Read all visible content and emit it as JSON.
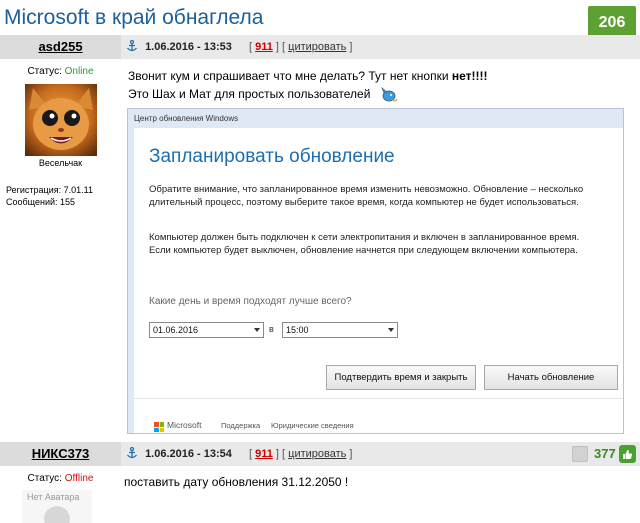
{
  "topic": {
    "title": "Microsoft в край обнаглела",
    "rating": "206",
    "vote_minus": "–",
    "vote_plus": "+"
  },
  "posts": [
    {
      "author": "asd255",
      "date": "1.06.2016 - 13:53",
      "post_number": "911",
      "cite_label": "цитировать",
      "status_label": "Статус:",
      "status": "Online",
      "rank": "Весельчак",
      "registration": "Регистрация: 7.01.11",
      "messages": "Сообщений: 155",
      "text_line1_prefix": "Звонит кум и спрашивает что мне делать? Тут нет кнопки ",
      "text_line1_bold": "нет!!!!",
      "text_line2": "Это Шах и Мат для простых пользователей"
    },
    {
      "author": "НИКС373",
      "date": "1.06.2016 - 13:54",
      "post_number": "911",
      "cite_label": "цитировать",
      "status_label": "Статус:",
      "status": "Offline",
      "score": "377",
      "avatar_placeholder": "Нет Аватара",
      "text": "поставить дату обновления 31.12.2050 !"
    }
  ],
  "windows_dialog": {
    "window_title": "Центр обновления Windows",
    "heading": "Запланировать обновление",
    "paragraph1": "Обратите внимание, что запланированное время изменить невозможно. Обновление – несколько длительный процесс, поэтому выберите такое время, когда компьютер не будет использоваться.",
    "paragraph2": "Компьютер должен быть подключен к сети электропитания и включен в запланированное время. Если компьютер будет выключен, обновление начнется при следующем включении компьютера.",
    "question": "Какие день и время подходят лучше всего?",
    "date_value": "01.06.2016",
    "in_label": "в",
    "time_value": "15:00",
    "confirm_button": "Подтвердить время и закрыть",
    "start_button": "Начать обновление",
    "brand": "Microsoft",
    "support_link": "Поддержка",
    "legal_link": "Юридические сведения",
    "brand_colors": [
      "#f25022",
      "#7fba00",
      "#00a4ef",
      "#ffb900"
    ]
  }
}
